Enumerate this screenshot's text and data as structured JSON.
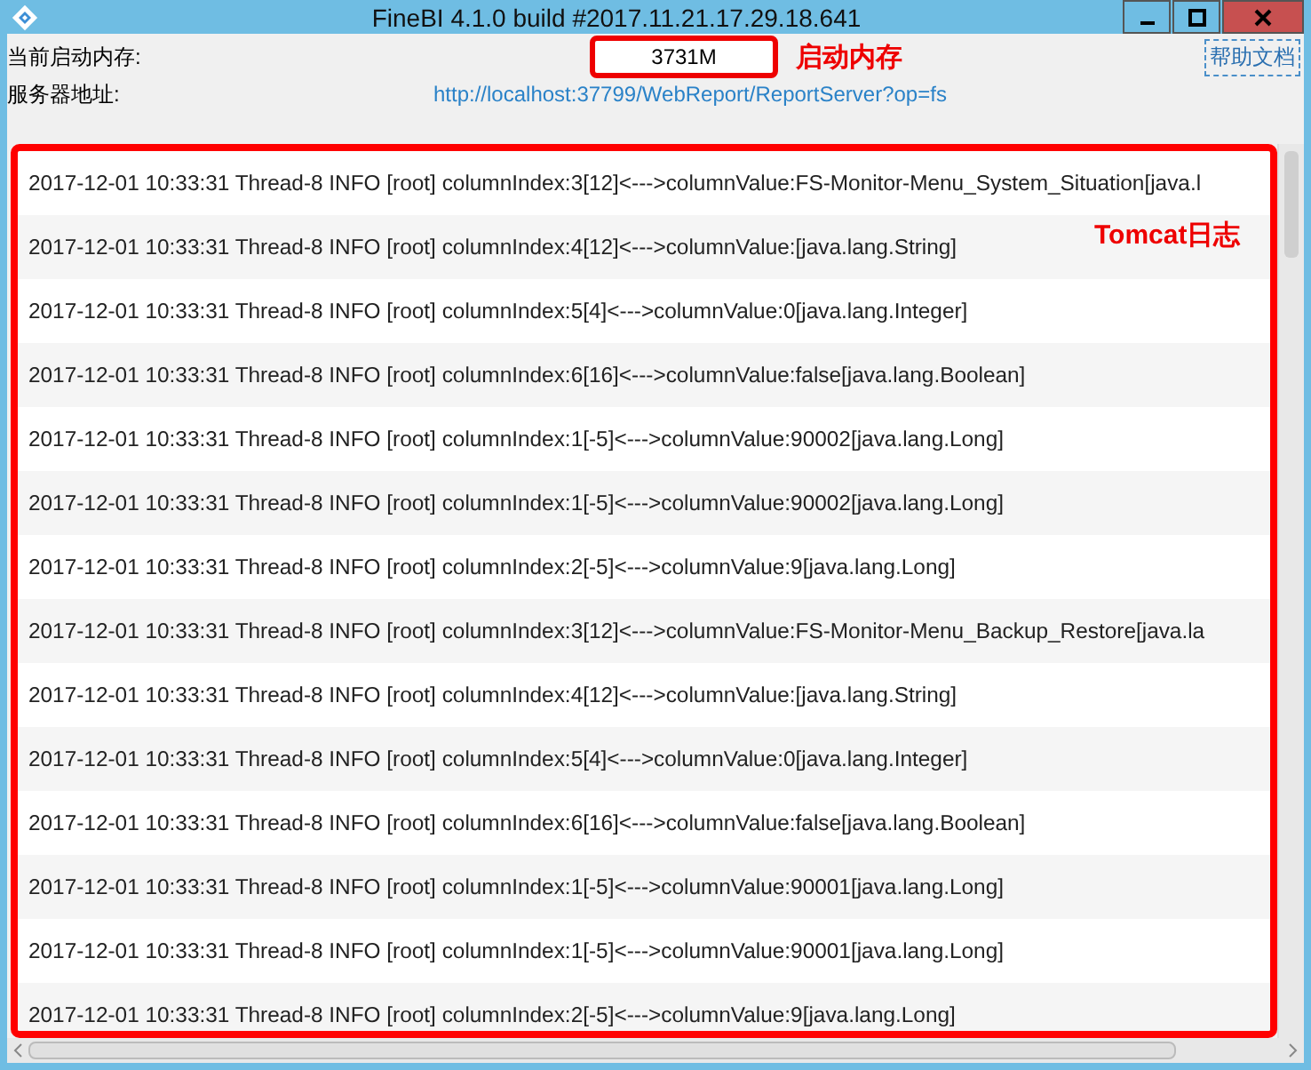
{
  "window": {
    "title": "FineBI 4.1.0 build #2017.11.21.17.29.18.641"
  },
  "memory": {
    "label": "当前启动内存:",
    "value": "3731M",
    "annotation": "启动内存"
  },
  "server": {
    "label": "服务器地址:",
    "url": "http://localhost:37799/WebReport/ReportServer?op=fs"
  },
  "help_link": "帮助文档",
  "log": {
    "annotation": "Tomcat日志",
    "lines": [
      "2017-12-01 10:33:31 Thread-8 INFO [root] columnIndex:3[12]<--->columnValue:FS-Monitor-Menu_System_Situation[java.l",
      "2017-12-01 10:33:31 Thread-8 INFO [root] columnIndex:4[12]<--->columnValue:[java.lang.String]",
      "2017-12-01 10:33:31 Thread-8 INFO [root] columnIndex:5[4]<--->columnValue:0[java.lang.Integer]",
      "2017-12-01 10:33:31 Thread-8 INFO [root] columnIndex:6[16]<--->columnValue:false[java.lang.Boolean]",
      "2017-12-01 10:33:31 Thread-8 INFO [root] columnIndex:1[-5]<--->columnValue:90002[java.lang.Long]",
      "2017-12-01 10:33:31 Thread-8 INFO [root] columnIndex:1[-5]<--->columnValue:90002[java.lang.Long]",
      "2017-12-01 10:33:31 Thread-8 INFO [root] columnIndex:2[-5]<--->columnValue:9[java.lang.Long]",
      "2017-12-01 10:33:31 Thread-8 INFO [root] columnIndex:3[12]<--->columnValue:FS-Monitor-Menu_Backup_Restore[java.la",
      "2017-12-01 10:33:31 Thread-8 INFO [root] columnIndex:4[12]<--->columnValue:[java.lang.String]",
      "2017-12-01 10:33:31 Thread-8 INFO [root] columnIndex:5[4]<--->columnValue:0[java.lang.Integer]",
      "2017-12-01 10:33:31 Thread-8 INFO [root] columnIndex:6[16]<--->columnValue:false[java.lang.Boolean]",
      "2017-12-01 10:33:31 Thread-8 INFO [root] columnIndex:1[-5]<--->columnValue:90001[java.lang.Long]",
      "2017-12-01 10:33:31 Thread-8 INFO [root] columnIndex:1[-5]<--->columnValue:90001[java.lang.Long]",
      "2017-12-01 10:33:31 Thread-8 INFO [root] columnIndex:2[-5]<--->columnValue:9[java.lang.Long]"
    ]
  }
}
